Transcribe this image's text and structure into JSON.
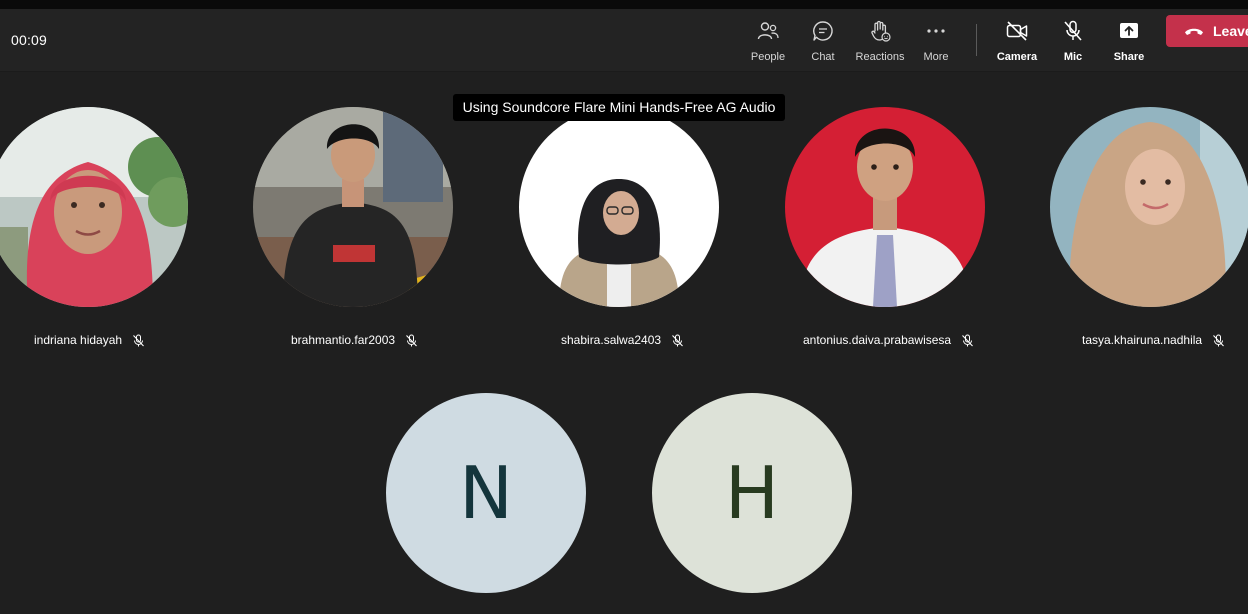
{
  "call": {
    "timer": "00:09",
    "audio_tooltip": "Using Soundcore Flare Mini Hands-Free AG Audio"
  },
  "toolbar": {
    "people_label": "People",
    "chat_label": "Chat",
    "reactions_label": "Reactions",
    "more_label": "More",
    "camera_label": "Camera",
    "mic_label": "Mic",
    "share_label": "Share",
    "leave_label": "Leave",
    "leave_color": "#c4314b"
  },
  "participants": [
    {
      "name": "indriana hidayah",
      "muted": true,
      "icon": "mic-off-icon"
    },
    {
      "name": "brahmantio.far2003",
      "muted": true,
      "icon": "mic-off-icon"
    },
    {
      "name": "shabira.salwa2403",
      "muted": true,
      "icon": "mic-off-icon"
    },
    {
      "name": "antonius.daiva.prabawisesa",
      "muted": true,
      "icon": "mic-off-icon"
    },
    {
      "name": "tasya.khairuna.nadhila",
      "muted": true,
      "icon": "mic-off-icon"
    }
  ],
  "initial_tiles": [
    {
      "initial": "N",
      "bg": "#cfdbe2",
      "fg": "#14353c"
    },
    {
      "initial": "H",
      "bg": "#dde2d8",
      "fg": "#283b20"
    }
  ]
}
